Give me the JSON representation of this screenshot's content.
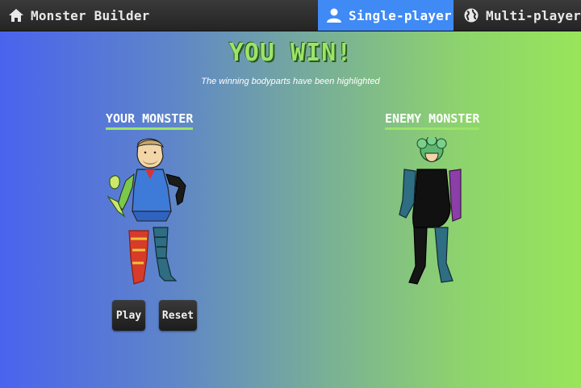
{
  "nav": {
    "home_label": "Monster Builder",
    "single_label": "Single-player",
    "multi_label": "Multi-player",
    "active_tab": "Single-player",
    "active_color": "#3f8af4"
  },
  "result": {
    "title": "YOU WIN!",
    "subtitle": "The winning bodyparts have been highlighted"
  },
  "monsters": {
    "player_label": "YOUR MONSTER",
    "enemy_label": "ENEMY MONSTER",
    "highlight_color": "#9be46a"
  },
  "buttons": {
    "play_label": "Play",
    "reset_label": "Reset"
  }
}
